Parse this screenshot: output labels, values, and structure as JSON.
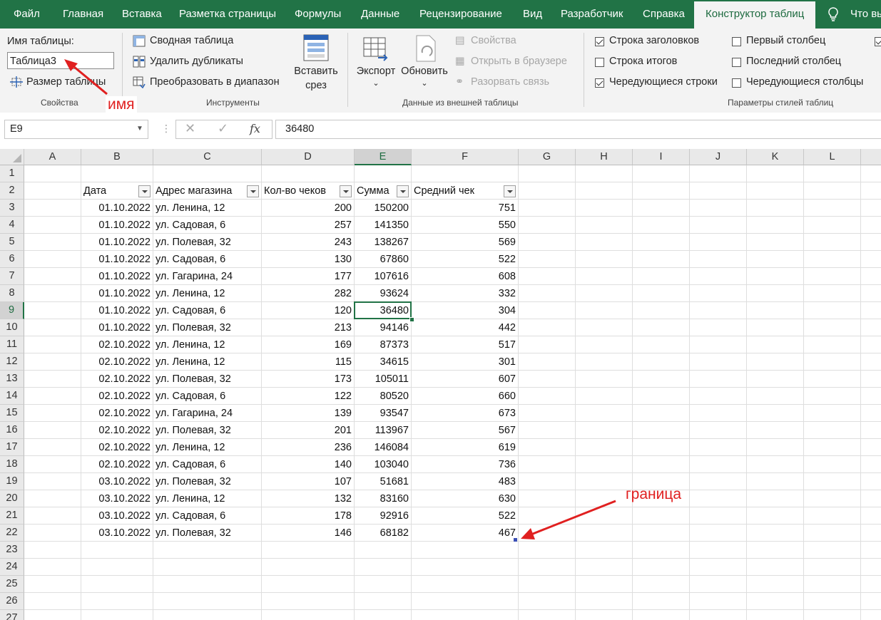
{
  "menu": {
    "tabs": [
      "Файл",
      "Главная",
      "Вставка",
      "Разметка страницы",
      "Формулы",
      "Данные",
      "Рецензирование",
      "Вид",
      "Разработчик",
      "Справка",
      "Конструктор таблиц",
      "Что вы"
    ],
    "active_tab": "Конструктор таблиц"
  },
  "ribbon": {
    "properties": {
      "name_label": "Имя таблицы:",
      "name_value": "Таблица3",
      "resize_label": "Размер таблицы",
      "group_label": "Свойства"
    },
    "tools": {
      "pivot": "Сводная таблица",
      "remove_dup": "Удалить дубликаты",
      "convert_range": "Преобразовать в диапазон",
      "insert_slicer_1": "Вставить",
      "insert_slicer_2": "срез",
      "group_label": "Инструменты"
    },
    "external": {
      "export": "Экспорт",
      "refresh": "Обновить",
      "properties": "Свойства",
      "open_browser": "Открыть в браузере",
      "unlink": "Разорвать связь",
      "group_label": "Данные из внешней таблицы"
    },
    "style_options": {
      "header_row": {
        "label": "Строка заголовков",
        "checked": true
      },
      "total_row": {
        "label": "Строка итогов",
        "checked": false
      },
      "banded_rows": {
        "label": "Чередующиеся строки",
        "checked": true
      },
      "first_column": {
        "label": "Первый столбец",
        "checked": false
      },
      "last_column": {
        "label": "Последний столбец",
        "checked": false
      },
      "banded_columns": {
        "label": "Чередующиеся столбцы",
        "checked": false
      },
      "group_label": "Параметры стилей таблиц"
    }
  },
  "formula_bar": {
    "name_box": "E9",
    "formula": "36480"
  },
  "columns": [
    "A",
    "B",
    "C",
    "D",
    "E",
    "F",
    "G",
    "H",
    "I",
    "J",
    "K",
    "L"
  ],
  "selected_column": "E",
  "selected_row": 9,
  "rows": [
    "1",
    "2",
    "3",
    "4",
    "5",
    "6",
    "7",
    "8",
    "9",
    "10",
    "11",
    "12",
    "13",
    "14",
    "15",
    "16",
    "17",
    "18",
    "19",
    "20",
    "21",
    "22",
    "23",
    "24",
    "25",
    "26",
    "27"
  ],
  "table": {
    "headers": [
      "Дата",
      "Адрес магазина",
      "Кол-во чеков",
      "Сумма",
      "Средний чек"
    ],
    "data": [
      [
        "01.10.2022",
        "ул. Ленина, 12",
        "200",
        "150200",
        "751"
      ],
      [
        "01.10.2022",
        "ул. Садовая, 6",
        "257",
        "141350",
        "550"
      ],
      [
        "01.10.2022",
        "ул. Полевая, 32",
        "243",
        "138267",
        "569"
      ],
      [
        "01.10.2022",
        "ул. Садовая, 6",
        "130",
        "67860",
        "522"
      ],
      [
        "01.10.2022",
        "ул. Гагарина, 24",
        "177",
        "107616",
        "608"
      ],
      [
        "01.10.2022",
        "ул. Ленина, 12",
        "282",
        "93624",
        "332"
      ],
      [
        "01.10.2022",
        "ул. Садовая, 6",
        "120",
        "36480",
        "304"
      ],
      [
        "01.10.2022",
        "ул. Полевая, 32",
        "213",
        "94146",
        "442"
      ],
      [
        "02.10.2022",
        "ул. Ленина, 12",
        "169",
        "87373",
        "517"
      ],
      [
        "02.10.2022",
        "ул. Ленина, 12",
        "115",
        "34615",
        "301"
      ],
      [
        "02.10.2022",
        "ул. Полевая, 32",
        "173",
        "105011",
        "607"
      ],
      [
        "02.10.2022",
        "ул. Садовая, 6",
        "122",
        "80520",
        "660"
      ],
      [
        "02.10.2022",
        "ул. Гагарина, 24",
        "139",
        "93547",
        "673"
      ],
      [
        "02.10.2022",
        "ул. Полевая, 32",
        "201",
        "113967",
        "567"
      ],
      [
        "02.10.2022",
        "ул. Ленина, 12",
        "236",
        "146084",
        "619"
      ],
      [
        "02.10.2022",
        "ул. Садовая, 6",
        "140",
        "103040",
        "736"
      ],
      [
        "03.10.2022",
        "ул. Полевая, 32",
        "107",
        "51681",
        "483"
      ],
      [
        "03.10.2022",
        "ул. Ленина, 12",
        "132",
        "83160",
        "630"
      ],
      [
        "03.10.2022",
        "ул. Садовая, 6",
        "178",
        "92916",
        "522"
      ],
      [
        "03.10.2022",
        "ул. Полевая, 32",
        "146",
        "68182",
        "467"
      ]
    ]
  },
  "annotations": {
    "name": "имя",
    "border": "граница",
    "color": "#e02020"
  },
  "colors": {
    "accent": "#217346",
    "ribbon": "#f3f3f3"
  }
}
